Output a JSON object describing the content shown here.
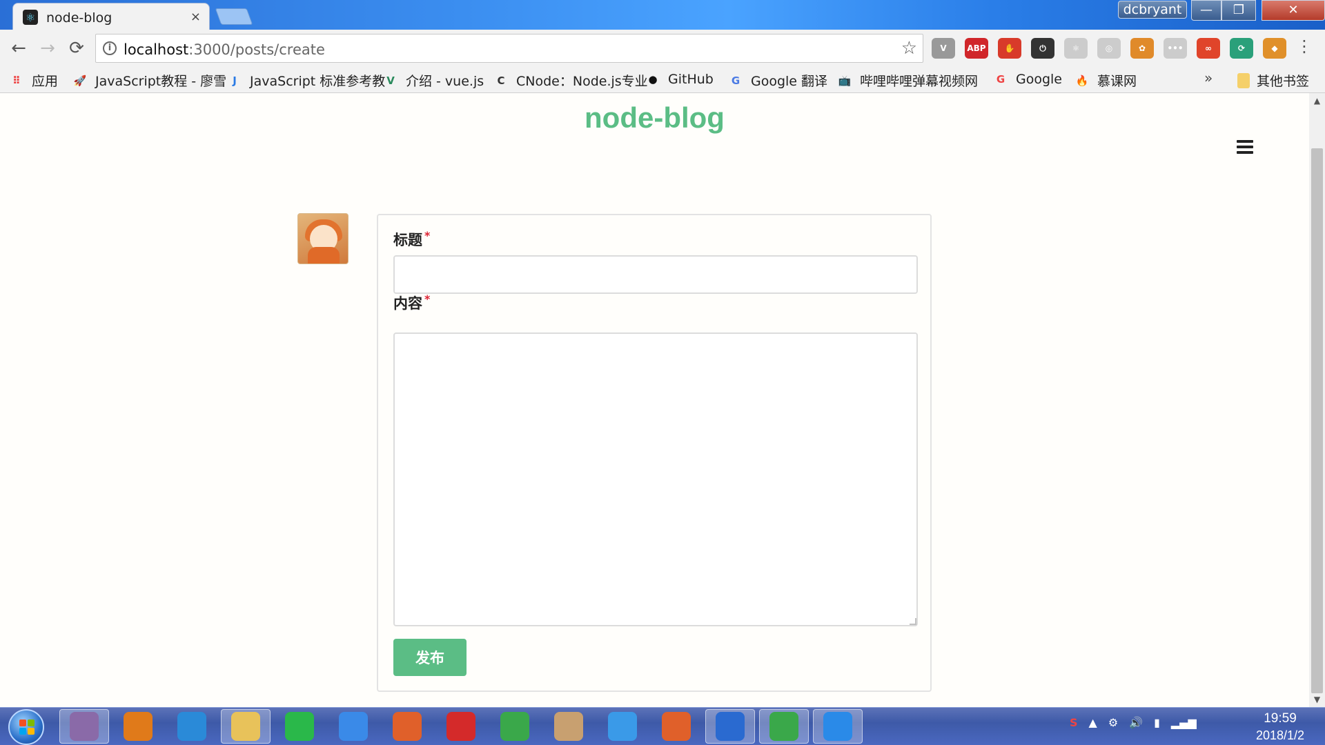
{
  "browser": {
    "tab_title": "node-blog",
    "tab_close": "×",
    "user": "dcbryant",
    "window_controls": {
      "minimize": "—",
      "maximize": "❐",
      "close": "✕"
    },
    "url_host": "localhost",
    "url_path": ":3000/posts/create",
    "nav": {
      "back": "←",
      "forward": "→",
      "reload": "⟳"
    },
    "star": "☆",
    "menu": "⋮",
    "extensions": [
      {
        "name": "vimium-icon",
        "label": "V",
        "color": "#999999"
      },
      {
        "name": "adblock-icon",
        "label": "ABP",
        "color": "#d0262a"
      },
      {
        "name": "stop-icon",
        "label": "✋",
        "color": "#d83a2a"
      },
      {
        "name": "power-icon",
        "label": "⏻",
        "color": "#333333"
      },
      {
        "name": "react-devtools-icon",
        "label": "⚛",
        "color": "#cccccc"
      },
      {
        "name": "circle-ext-icon",
        "label": "◎",
        "color": "#cccccc"
      },
      {
        "name": "pinwheel-icon",
        "label": "✿",
        "color": "#e08a2a"
      },
      {
        "name": "dots-ext-icon",
        "label": "•••",
        "color": "#cccccc"
      },
      {
        "name": "infinity-icon",
        "label": "∞",
        "color": "#e0442a"
      },
      {
        "name": "proxy-icon",
        "label": "⟳",
        "color": "#2aa07a"
      },
      {
        "name": "fish-icon",
        "label": "◆",
        "color": "#e0902a"
      }
    ]
  },
  "bookmarks": {
    "items": [
      {
        "name": "bookmark-apps",
        "icon": "apps-grid-icon",
        "glyph": "⠿",
        "color": "#e44",
        "label": "应用"
      },
      {
        "name": "bookmark-javascript-tutorial",
        "icon": "rocket-icon",
        "glyph": "🚀",
        "color": "#39c",
        "label": "JavaScript教程 - 廖雪"
      },
      {
        "name": "bookmark-javascript-reference",
        "icon": "j-icon",
        "glyph": "J",
        "color": "#2a7ae4",
        "label": "JavaScript 标准参考教"
      },
      {
        "name": "bookmark-vuejs",
        "icon": "vue-icon",
        "glyph": "V",
        "color": "#2a8a5c",
        "label": "介绍 - vue.js"
      },
      {
        "name": "bookmark-cnode",
        "icon": "cnode-icon",
        "glyph": "C",
        "color": "#333",
        "label": "CNode：Node.js专业"
      },
      {
        "name": "bookmark-github",
        "icon": "github-icon",
        "glyph": "●",
        "color": "#111",
        "label": "GitHub"
      },
      {
        "name": "bookmark-google-translate",
        "icon": "translate-icon",
        "glyph": "G",
        "color": "#4a7ae4",
        "label": "Google 翻译"
      },
      {
        "name": "bookmark-bilibili",
        "icon": "bilibili-icon",
        "glyph": "📺",
        "color": "#2aa0e4",
        "label": "哔哩哔哩弹幕视频网"
      },
      {
        "name": "bookmark-google",
        "icon": "google-icon",
        "glyph": "G",
        "color": "#e44",
        "label": "Google"
      },
      {
        "name": "bookmark-imooc",
        "icon": "flame-icon",
        "glyph": "🔥",
        "color": "#e44",
        "label": "慕课网"
      }
    ],
    "more": "»",
    "other_folder": "其他书签"
  },
  "page": {
    "site_title": "node-blog",
    "form": {
      "title_label": "标题",
      "title_value": "",
      "content_label": "内容",
      "content_value": "",
      "required_mark": "*",
      "submit_label": "发布"
    }
  },
  "taskbar": {
    "apps": [
      {
        "name": "taskbar-git-app",
        "color": "#8a6aa8"
      },
      {
        "name": "taskbar-search-app",
        "color": "#e07a1a"
      },
      {
        "name": "taskbar-ie-app",
        "color": "#2a8ad8"
      },
      {
        "name": "taskbar-explorer-app",
        "color": "#e8c25a"
      },
      {
        "name": "taskbar-iqiyi-app",
        "color": "#2ab84a"
      },
      {
        "name": "taskbar-baidu-netdisk-app",
        "color": "#3a8ae8"
      },
      {
        "name": "taskbar-pdf-app",
        "color": "#e0602a"
      },
      {
        "name": "taskbar-netease-music-app",
        "color": "#d42a2a"
      },
      {
        "name": "taskbar-chrome-app",
        "color": "#3aa84a"
      },
      {
        "name": "taskbar-paint-app",
        "color": "#c8a070"
      },
      {
        "name": "taskbar-bird-app",
        "color": "#3a9ae8"
      },
      {
        "name": "taskbar-feather-app",
        "color": "#e0602a"
      },
      {
        "name": "taskbar-vscode-app",
        "color": "#2a6ad0"
      },
      {
        "name": "taskbar-chrome-active-app",
        "color": "#3aa84a"
      },
      {
        "name": "taskbar-phone-app",
        "color": "#2a8ae8"
      }
    ],
    "time": "19:59",
    "date": "2018/1/2"
  }
}
